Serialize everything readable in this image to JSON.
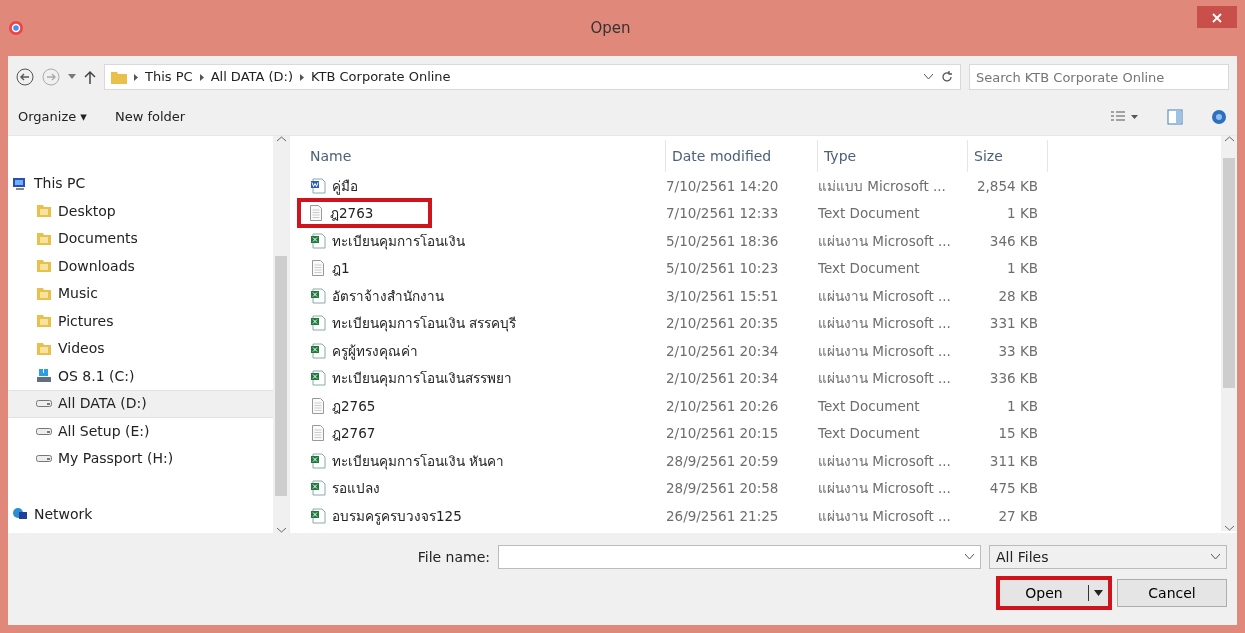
{
  "window": {
    "title": "Open"
  },
  "address": {
    "crumbs": [
      "This PC",
      "All DATA (D:)",
      "KTB Corporate Online"
    ],
    "search_placeholder": "Search KTB Corporate Online"
  },
  "toolbar": {
    "organize": "Organize ▾",
    "new_folder": "New folder"
  },
  "nav": [
    {
      "label": "This PC",
      "kind": "computer",
      "selected": false,
      "children": [
        {
          "label": "Desktop",
          "kind": "folder",
          "selected": false
        },
        {
          "label": "Documents",
          "kind": "folder",
          "selected": false
        },
        {
          "label": "Downloads",
          "kind": "folder",
          "selected": false
        },
        {
          "label": "Music",
          "kind": "folder",
          "selected": false
        },
        {
          "label": "Pictures",
          "kind": "folder",
          "selected": false
        },
        {
          "label": "Videos",
          "kind": "folder",
          "selected": false
        },
        {
          "label": "OS 8.1 (C:)",
          "kind": "system-drive",
          "selected": false
        },
        {
          "label": "All DATA (D:)",
          "kind": "drive",
          "selected": true
        },
        {
          "label": "All Setup (E:)",
          "kind": "drive",
          "selected": false
        },
        {
          "label": "My Passport (H:)",
          "kind": "drive",
          "selected": false
        }
      ]
    },
    {
      "label": "Network",
      "kind": "network",
      "selected": false
    }
  ],
  "table": {
    "columns": [
      "Name",
      "Date modified",
      "Type",
      "Size"
    ],
    "rows": [
      {
        "kind": "word",
        "name": "คู่มือ",
        "date": "7/10/2561 14:20",
        "type": "แม่แบบ Microsoft ...",
        "size": "2,854 KB",
        "highlighted": false
      },
      {
        "kind": "text",
        "name": "ฎ2763",
        "date": "7/10/2561 12:33",
        "type": "Text Document",
        "size": "1 KB",
        "highlighted": true
      },
      {
        "kind": "excel",
        "name": "ทะเบียนคุมการโอนเงิน",
        "date": "5/10/2561 18:36",
        "type": "แผ่นงาน Microsoft ...",
        "size": "346 KB",
        "highlighted": false
      },
      {
        "kind": "text",
        "name": "ฎ1",
        "date": "5/10/2561 10:23",
        "type": "Text Document",
        "size": "1 KB",
        "highlighted": false
      },
      {
        "kind": "excel",
        "name": "อัตราจ้างสำนักงาน",
        "date": "3/10/2561 15:51",
        "type": "แผ่นงาน Microsoft ...",
        "size": "28 KB",
        "highlighted": false
      },
      {
        "kind": "excel",
        "name": "ทะเบียนคุมการโอนเงิน สรรคบุรี",
        "date": "2/10/2561 20:35",
        "type": "แผ่นงาน Microsoft ...",
        "size": "331 KB",
        "highlighted": false
      },
      {
        "kind": "excel",
        "name": "ครูผู้ทรงคุณค่า",
        "date": "2/10/2561 20:34",
        "type": "แผ่นงาน Microsoft ...",
        "size": "33 KB",
        "highlighted": false
      },
      {
        "kind": "excel",
        "name": "ทะเบียนคุมการโอนเงินสรรพยา",
        "date": "2/10/2561 20:34",
        "type": "แผ่นงาน Microsoft ...",
        "size": "336 KB",
        "highlighted": false
      },
      {
        "kind": "text",
        "name": "ฎ2765",
        "date": "2/10/2561 20:26",
        "type": "Text Document",
        "size": "1 KB",
        "highlighted": false
      },
      {
        "kind": "text",
        "name": "ฎ2767",
        "date": "2/10/2561 20:15",
        "type": "Text Document",
        "size": "15 KB",
        "highlighted": false
      },
      {
        "kind": "excel",
        "name": "ทะเบียนคุมการโอนเงิน หันคา",
        "date": "28/9/2561 20:59",
        "type": "แผ่นงาน Microsoft ...",
        "size": "311 KB",
        "highlighted": false
      },
      {
        "kind": "excel",
        "name": "รอแปลง",
        "date": "28/9/2561 20:58",
        "type": "แผ่นงาน Microsoft ...",
        "size": "475 KB",
        "highlighted": false
      },
      {
        "kind": "excel",
        "name": "อบรมครูครบวงจร125",
        "date": "26/9/2561 21:25",
        "type": "แผ่นงาน Microsoft ...",
        "size": "27 KB",
        "highlighted": false
      }
    ]
  },
  "footer": {
    "file_name_label": "File name:",
    "filter": "All Files",
    "open": "Open",
    "open_highlighted": true,
    "cancel": "Cancel"
  }
}
